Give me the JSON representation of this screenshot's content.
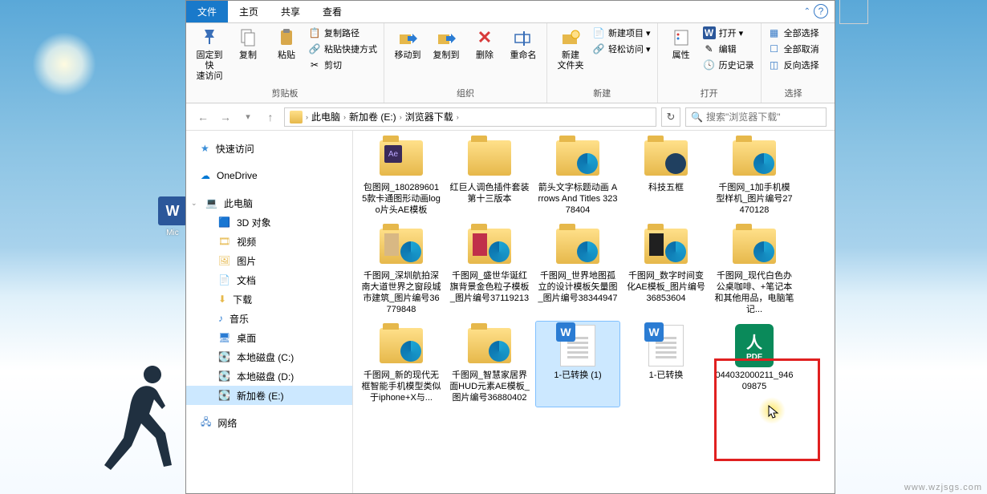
{
  "desktop_icon": {
    "label": "Mic",
    "glyph": "W"
  },
  "ribbon_tabs": {
    "file": "文件",
    "home": "主页",
    "share": "共享",
    "view": "查看"
  },
  "ribbon": {
    "clipboard": {
      "pin": "固定到快\n速访问",
      "copy": "复制",
      "paste": "粘贴",
      "copy_path": "复制路径",
      "paste_shortcut": "粘贴快捷方式",
      "cut": "剪切",
      "group": "剪贴板"
    },
    "organize": {
      "move_to": "移动到",
      "copy_to": "复制到",
      "delete": "删除",
      "rename": "重命名",
      "group": "组织"
    },
    "new": {
      "new_folder": "新建\n文件夹",
      "new_item": "新建项目 ▾",
      "easy_access": "轻松访问 ▾",
      "group": "新建"
    },
    "open": {
      "properties": "属性",
      "open": "打开 ▾",
      "edit": "编辑",
      "history": "历史记录",
      "group": "打开"
    },
    "select": {
      "all": "全部选择",
      "none": "全部取消",
      "invert": "反向选择",
      "group": "选择"
    }
  },
  "addressbar": {
    "this_pc": "此电脑",
    "drive": "新加卷 (E:)",
    "folder": "浏览器下载"
  },
  "search": {
    "placeholder": "搜索\"浏览器下载\""
  },
  "sidebar": {
    "quick_access": "快速访问",
    "onedrive": "OneDrive",
    "this_pc": "此电脑",
    "objects_3d": "3D 对象",
    "videos": "视频",
    "pictures": "图片",
    "documents": "文档",
    "downloads": "下载",
    "music": "音乐",
    "desktop": "桌面",
    "disk_c": "本地磁盘 (C:)",
    "disk_d": "本地磁盘 (D:)",
    "drive_e": "新加卷 (E:)",
    "network": "网络"
  },
  "files": {
    "r1c1": "包图网_1802896015款卡通图形动画logo片头AE模板",
    "r1c2": "红巨人调色插件套装第十三版本",
    "r1c3": "箭头文字标题动画 Arrows And Titles 32378404",
    "r1c4": "科技五框",
    "r1c5": "千图网_1加手机模型样机_图片编号27470128",
    "r2c1": "千图网_深圳航拍深南大道世界之窗段城市建筑_图片编号36779848",
    "r2c2": "千图网_盛世华诞红旗背景金色粒子模板_图片编号37119213",
    "r2c3": "千图网_世界地图孤立的设计模板矢量图_图片编号38344947",
    "r2c4": "千图网_数字时间变化AE模板_图片编号36853604",
    "r2c5": "千图网_现代白色办公桌咖啡、+笔记本和其他用品，电脑笔记...",
    "r3c1": "千图网_新的现代无框智能手机模型类似于iphone+X与...",
    "r3c2": "千图网_智慧家居界面HUD元素AE模板_图片编号36880402",
    "r3c3": "1-已转换 (1)",
    "r3c4": "1-已转换",
    "r3c5": "044032000211_94609875"
  },
  "watermark": "www.wzjsgs.com"
}
